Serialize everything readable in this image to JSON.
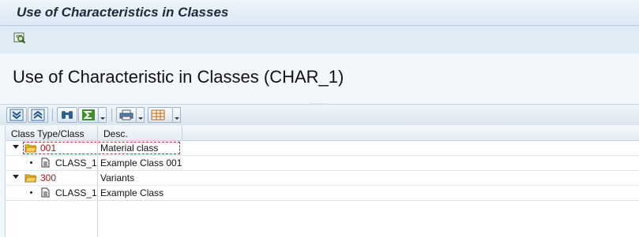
{
  "window": {
    "title": "Use of Characteristics in Classes"
  },
  "appbar": {
    "icon": "display-icon"
  },
  "page": {
    "heading": "Use of Characteristic in Classes (CHAR_1)"
  },
  "toolbar": {
    "buttons": [
      "expand-all-icon",
      "collapse-all-icon",
      "find-icon",
      "sum-icon",
      "print-icon",
      "layout-icon"
    ]
  },
  "tree": {
    "columns": [
      "Class Type/Class",
      "Desc."
    ],
    "rows": [
      {
        "level": 0,
        "node": "001",
        "desc": "Material class",
        "expanded": true
      },
      {
        "level": 1,
        "node": "CLASS_1",
        "desc": "Example Class 001"
      },
      {
        "level": 0,
        "node": "300",
        "desc": "Variants",
        "expanded": true
      },
      {
        "level": 1,
        "node": "CLASS_1",
        "desc": "Example Class"
      }
    ]
  },
  "colors": {
    "class_type_code": "#a1191e",
    "focus_border": "#c0262b",
    "folder": "#f0b62c"
  }
}
